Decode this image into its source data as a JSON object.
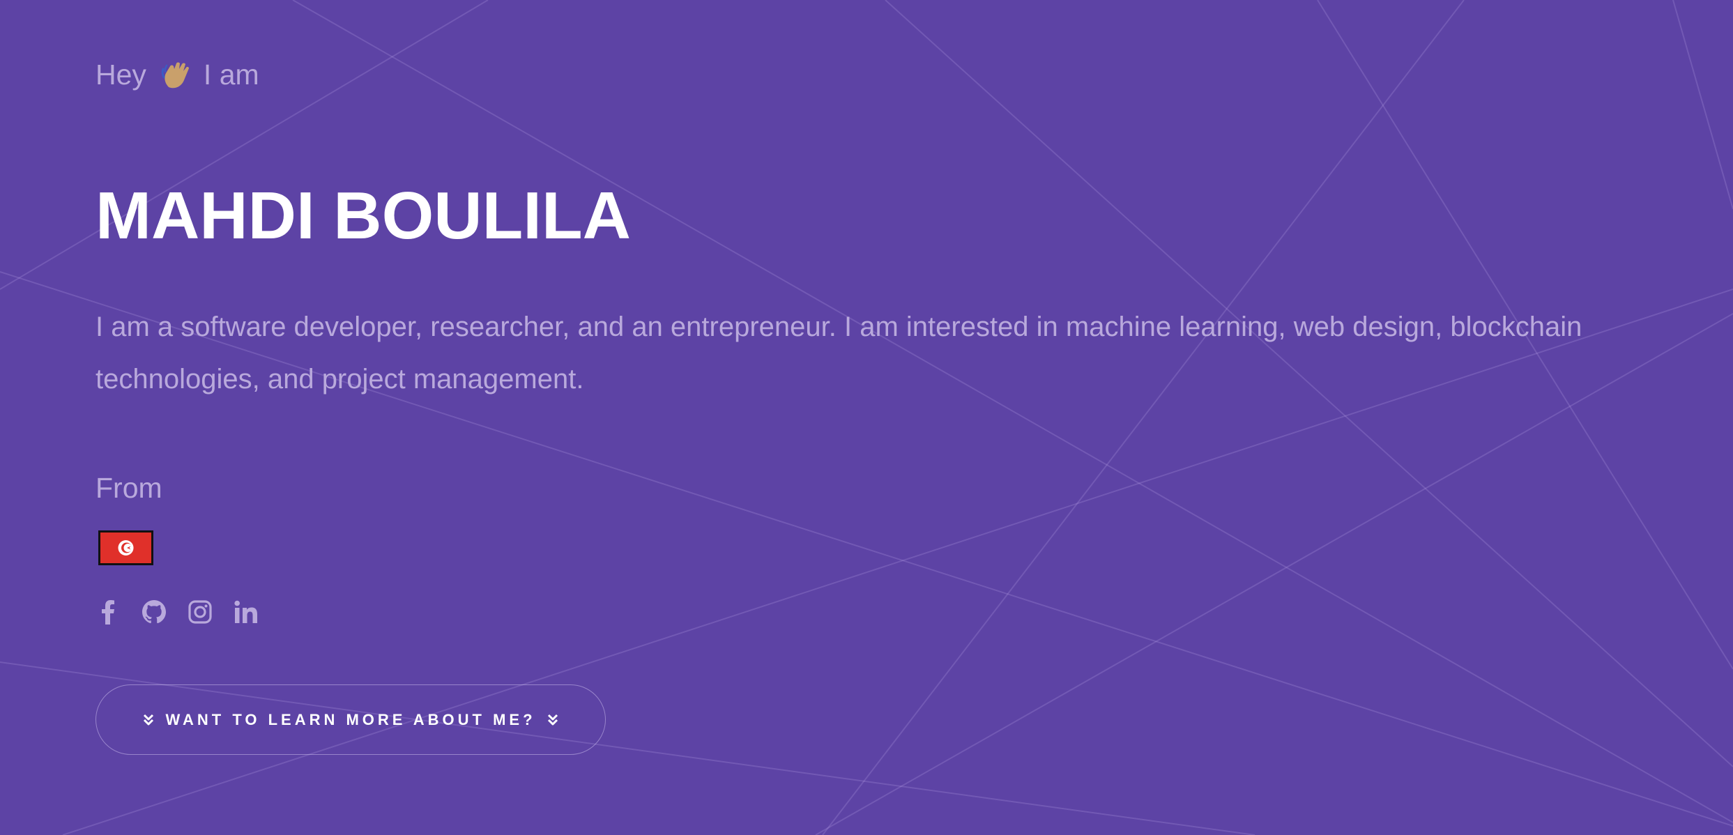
{
  "hero": {
    "greeting_prefix": "Hey",
    "greeting_suffix": "I am",
    "name": "MAHDI BOULILA",
    "bio": "I am a software developer, researcher, and an entrepreneur. I am interested in machine learning, web design, blockchain technologies, and project management.",
    "from_label": "From"
  },
  "flag": {
    "icon": "tunisia-flag-icon",
    "color": "#e0302a"
  },
  "socials": [
    {
      "icon": "facebook-icon"
    },
    {
      "icon": "github-icon"
    },
    {
      "icon": "instagram-icon"
    },
    {
      "icon": "linkedin-icon"
    }
  ],
  "cta": {
    "label": "WANT TO LEARN MORE ABOUT ME?",
    "icon": "double-chevron-down-icon"
  },
  "colors": {
    "background": "#5d43a5",
    "muted_text": "#b9a9dc",
    "title_text": "#ffffff"
  }
}
